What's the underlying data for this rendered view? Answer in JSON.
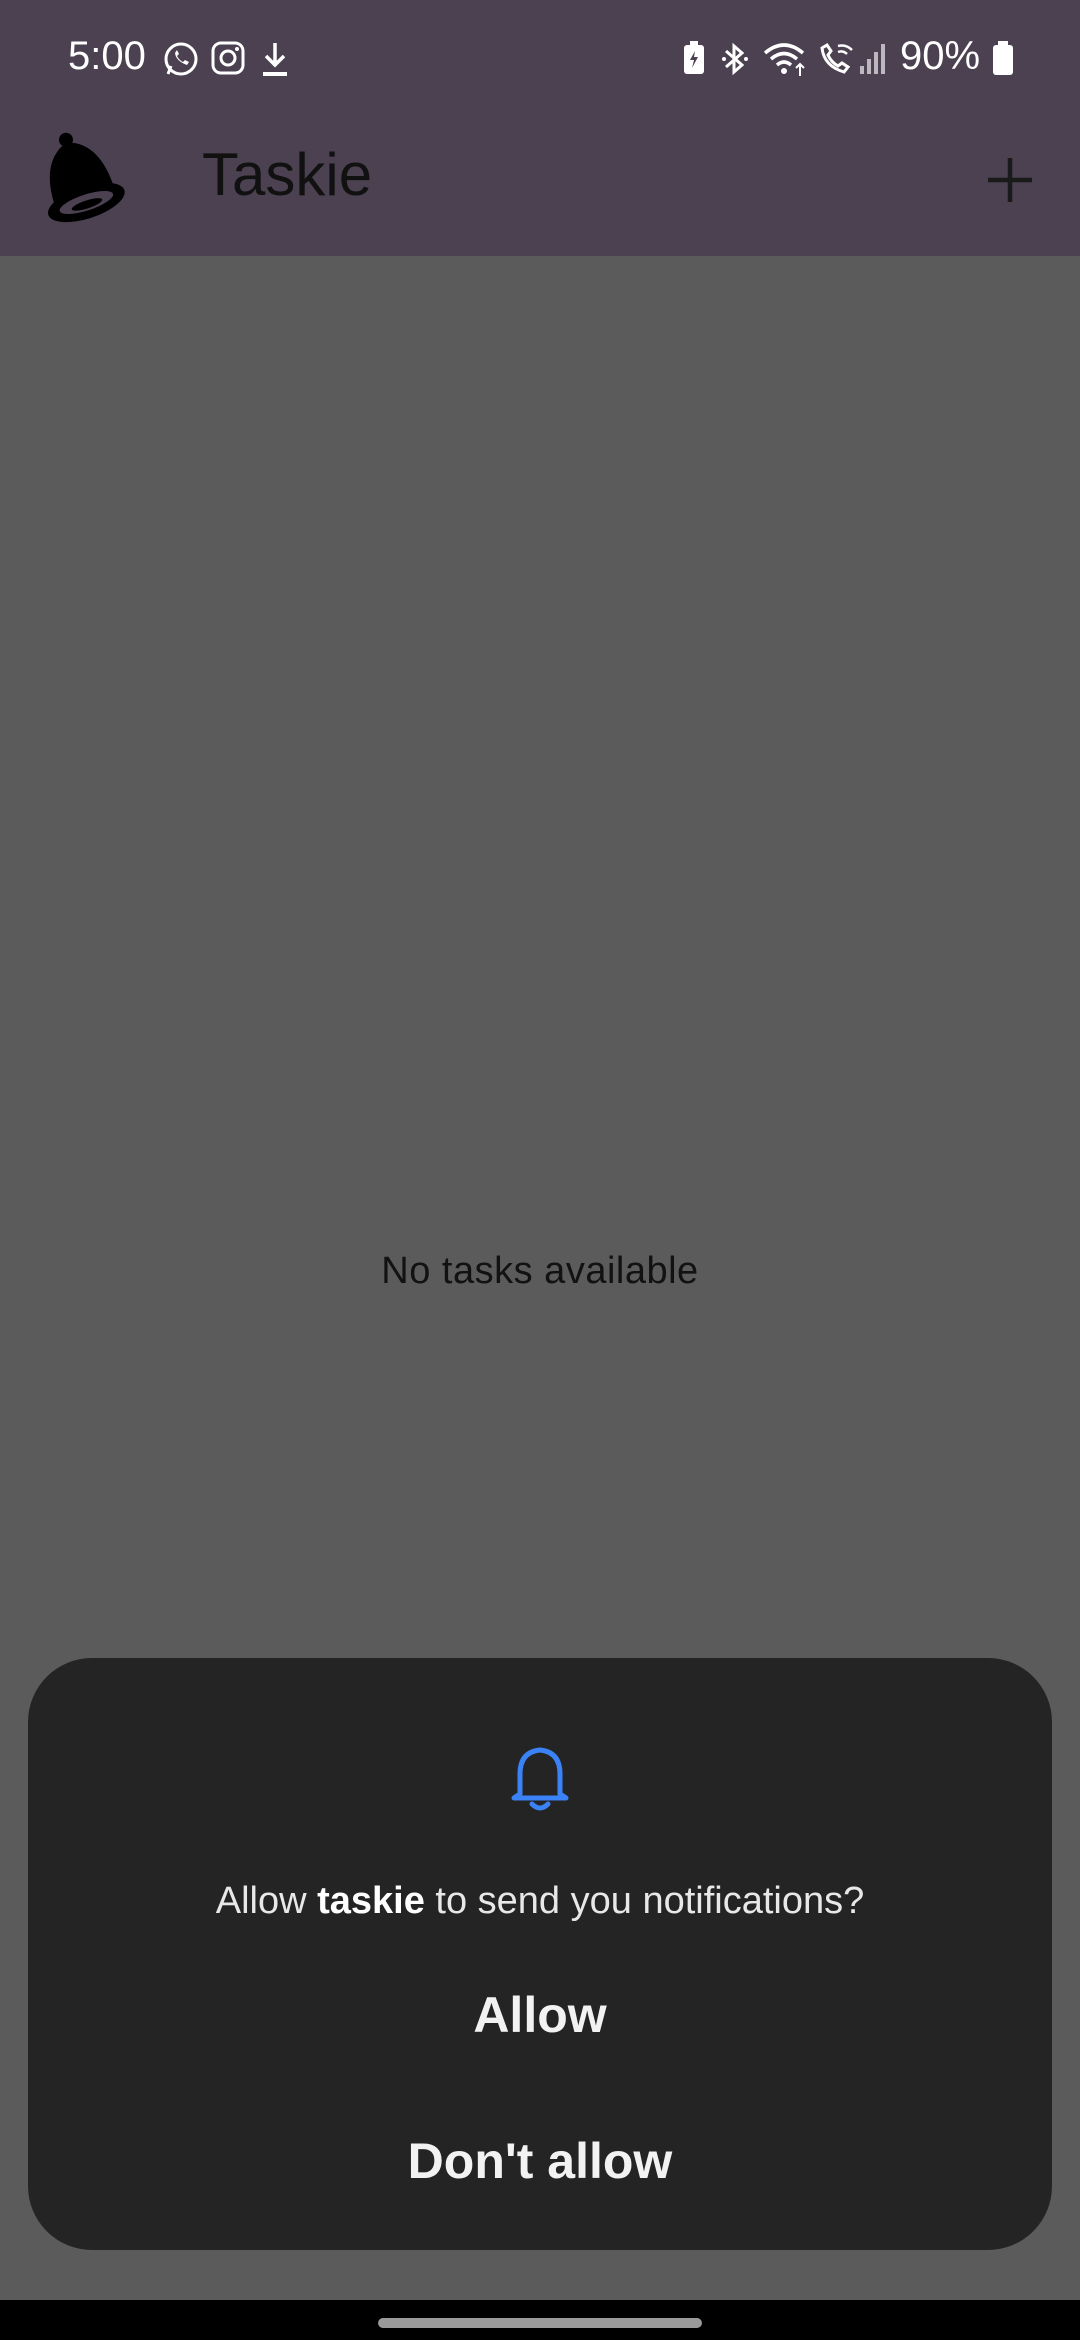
{
  "status_bar": {
    "time": "5:00",
    "battery": "90%",
    "icons": [
      "whatsapp-icon",
      "instagram-icon",
      "download-icon",
      "battery-saver-icon",
      "bluetooth-icon",
      "wifi-icon",
      "wifi-calling-icon",
      "signal-icon",
      "battery-icon"
    ]
  },
  "app_bar": {
    "title": "Taskie",
    "add_icon": "plus-icon",
    "logo_icon": "bell-icon"
  },
  "main": {
    "empty_message": "No tasks available"
  },
  "dialog": {
    "icon": "bell-outline-icon",
    "message_prefix": "Allow ",
    "app_name": "taskie",
    "message_suffix": " to send you notifications?",
    "allow_label": "Allow",
    "dont_allow_label": "Don't allow"
  },
  "colors": {
    "app_bar": "#4b4151",
    "scrim_background": "#5b5b5b",
    "dialog_background": "#242424",
    "accent_blue": "#3b82f6"
  }
}
